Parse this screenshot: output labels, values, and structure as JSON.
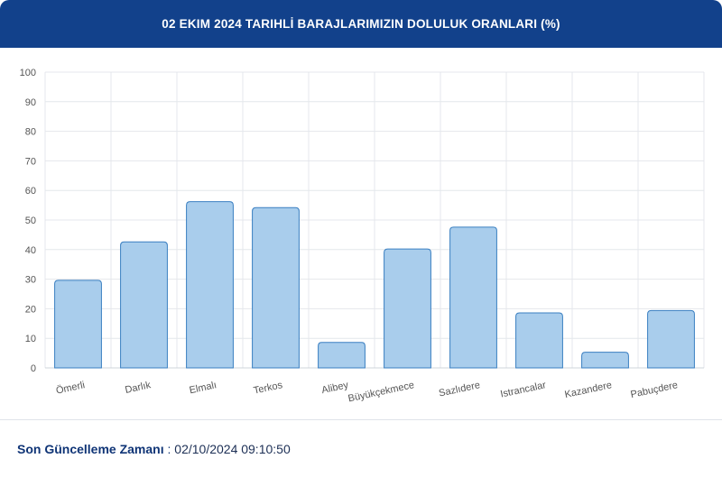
{
  "header": {
    "title": "02 EKIM 2024 TARIHLİ BARAJLARIMIZIN DOLULUK ORANLARI (%)"
  },
  "footer": {
    "label": "Son Güncelleme Zamanı",
    "separator": " : ",
    "value": "02/10/2024 09:10:50"
  },
  "colors": {
    "header_bg": "#12418b",
    "bar_fill": "#a9cdec",
    "bar_stroke": "#3a7fc1"
  },
  "chart_data": {
    "type": "bar",
    "title": "02 EKIM 2024 TARIHLİ BARAJLARIMIZIN DOLULUK ORANLARI (%)",
    "xlabel": "",
    "ylabel": "",
    "ylim": [
      0,
      100
    ],
    "yticks": [
      0,
      10,
      20,
      30,
      40,
      50,
      60,
      70,
      80,
      90,
      100
    ],
    "grid": true,
    "categories": [
      "Ömerli",
      "Darlık",
      "Elmalı",
      "Terkos",
      "Alibey",
      "Büyükçekmece",
      "Sazlıdere",
      "Istrancalar",
      "Kazandere",
      "Pabuçdere"
    ],
    "values": [
      29.6,
      42.6,
      56.2,
      54.2,
      8.6,
      40.2,
      47.6,
      18.6,
      5.3,
      19.4
    ]
  }
}
